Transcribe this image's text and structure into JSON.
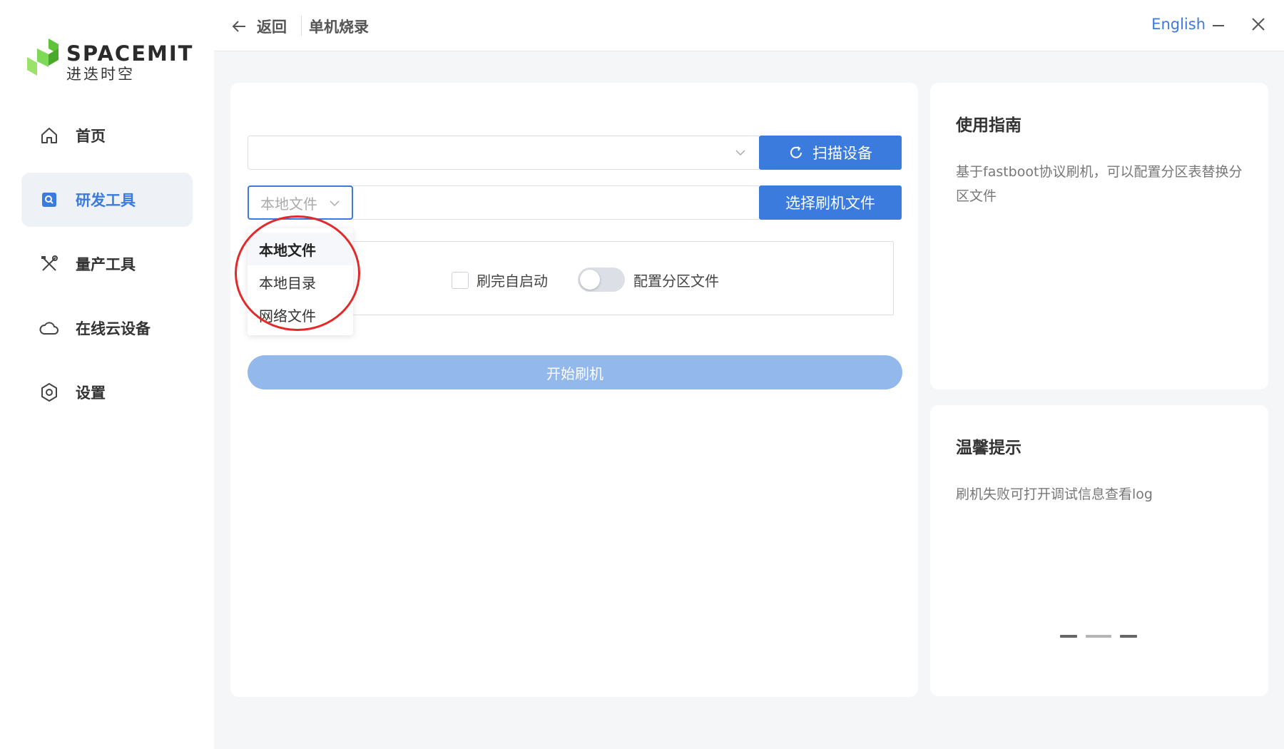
{
  "logo": {
    "en": "SPACEMIT",
    "cn": "进迭时空"
  },
  "sidebar": {
    "items": [
      {
        "label": "首页",
        "icon": "home-icon",
        "active": false
      },
      {
        "label": "研发工具",
        "icon": "dev-tools-icon",
        "active": true
      },
      {
        "label": "量产工具",
        "icon": "tools-icon",
        "active": false
      },
      {
        "label": "在线云设备",
        "icon": "cloud-icon",
        "active": false
      },
      {
        "label": "设置",
        "icon": "settings-icon",
        "active": false
      }
    ]
  },
  "header": {
    "back_label": "返回",
    "breadcrumb": "单机烧录",
    "language": "English"
  },
  "main": {
    "device_select_value": "",
    "scan_button": "扫描设备",
    "source_type_value": "本地文件",
    "choose_file_button": "选择刷机文件",
    "dropdown_options": [
      "本地文件",
      "本地目录",
      "网络文件"
    ],
    "auto_start_label": "刷完自启动",
    "auto_start_checked": false,
    "partition_label": "配置分区文件",
    "partition_enabled": false,
    "start_button": "开始刷机"
  },
  "guide": {
    "title": "使用指南",
    "text": "基于fastboot协议刷机，可以配置分区表替换分区文件"
  },
  "tips": {
    "title": "温馨提示",
    "text": "刷机失败可打开调试信息查看log"
  },
  "colors": {
    "accent": "#3b7bde",
    "disabled": "#93b9ec",
    "annotation": "#e32a2a"
  }
}
